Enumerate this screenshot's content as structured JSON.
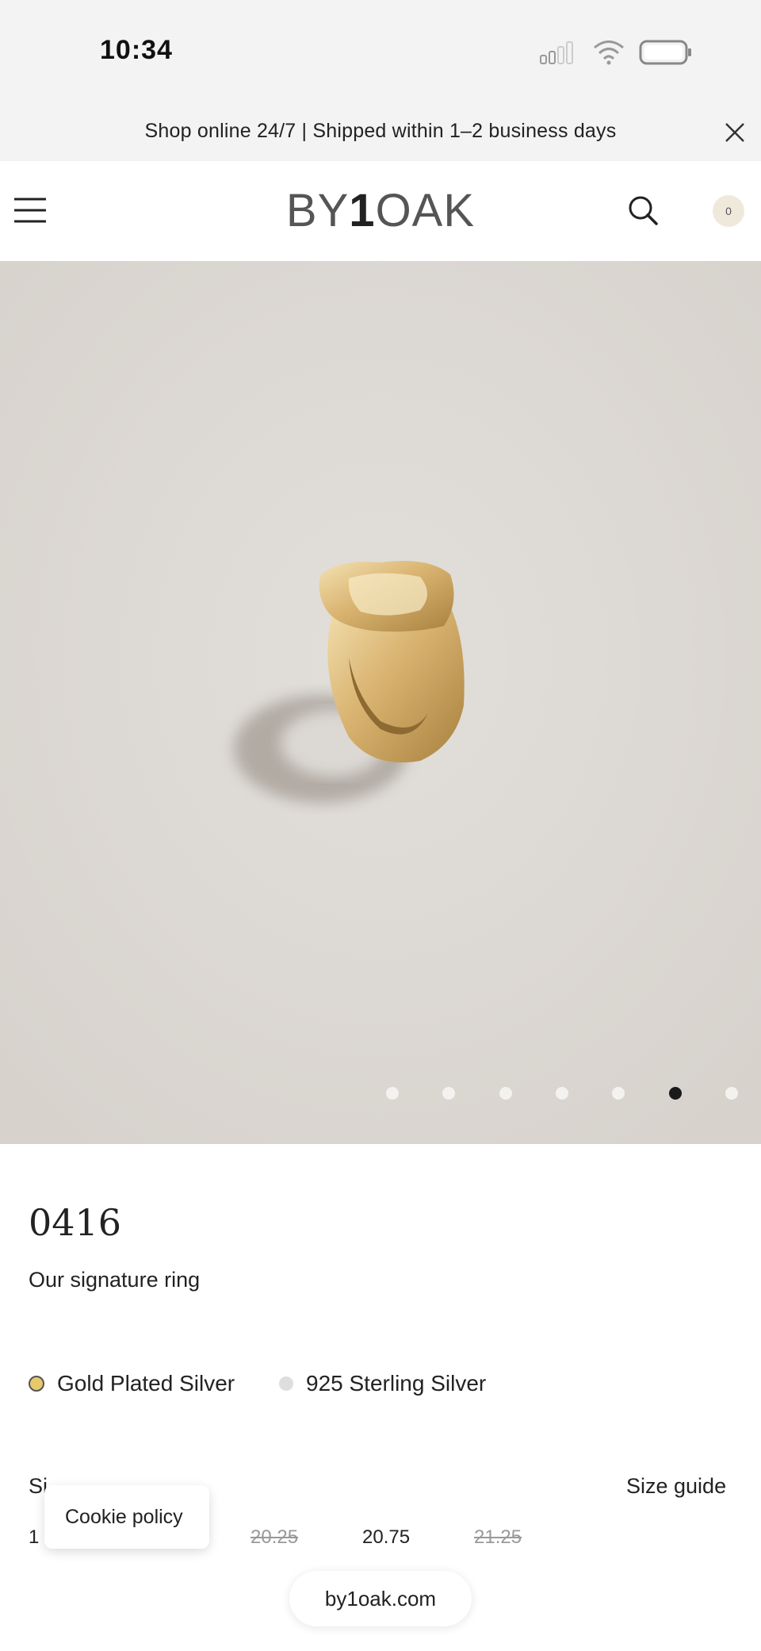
{
  "status_bar": {
    "time": "10:34",
    "icons": [
      "signal-icon",
      "wifi-icon",
      "battery-icon"
    ]
  },
  "announcement": {
    "text": "Shop online 24/7 | Shipped within 1–2 business days",
    "close_icon": "close-icon"
  },
  "header": {
    "menu_icon": "menu-icon",
    "logo": {
      "part1": "BY",
      "part2": "1",
      "part3": "OAK"
    },
    "search_icon": "search-icon",
    "cart_count": "0"
  },
  "gallery": {
    "slide_count": 7,
    "active_index": 5,
    "background": "#dcd8d3"
  },
  "product": {
    "title": "0416",
    "subtitle": "Our signature ring",
    "variants": [
      {
        "label": "Gold Plated Silver",
        "color": "#e6c96a",
        "selected": true
      },
      {
        "label": "925 Sterling Silver",
        "color": "#dedede",
        "selected": false
      }
    ],
    "size_label": "Si",
    "size_guide": "Size guide",
    "sizes": [
      {
        "label": "1",
        "available": true
      },
      {
        "label": "20.25",
        "available": false
      },
      {
        "label": "20.75",
        "available": true
      },
      {
        "label": "21.25",
        "available": false
      }
    ]
  },
  "cookie_popup": {
    "label": "Cookie policy"
  },
  "browser": {
    "url": "by1oak.com"
  }
}
